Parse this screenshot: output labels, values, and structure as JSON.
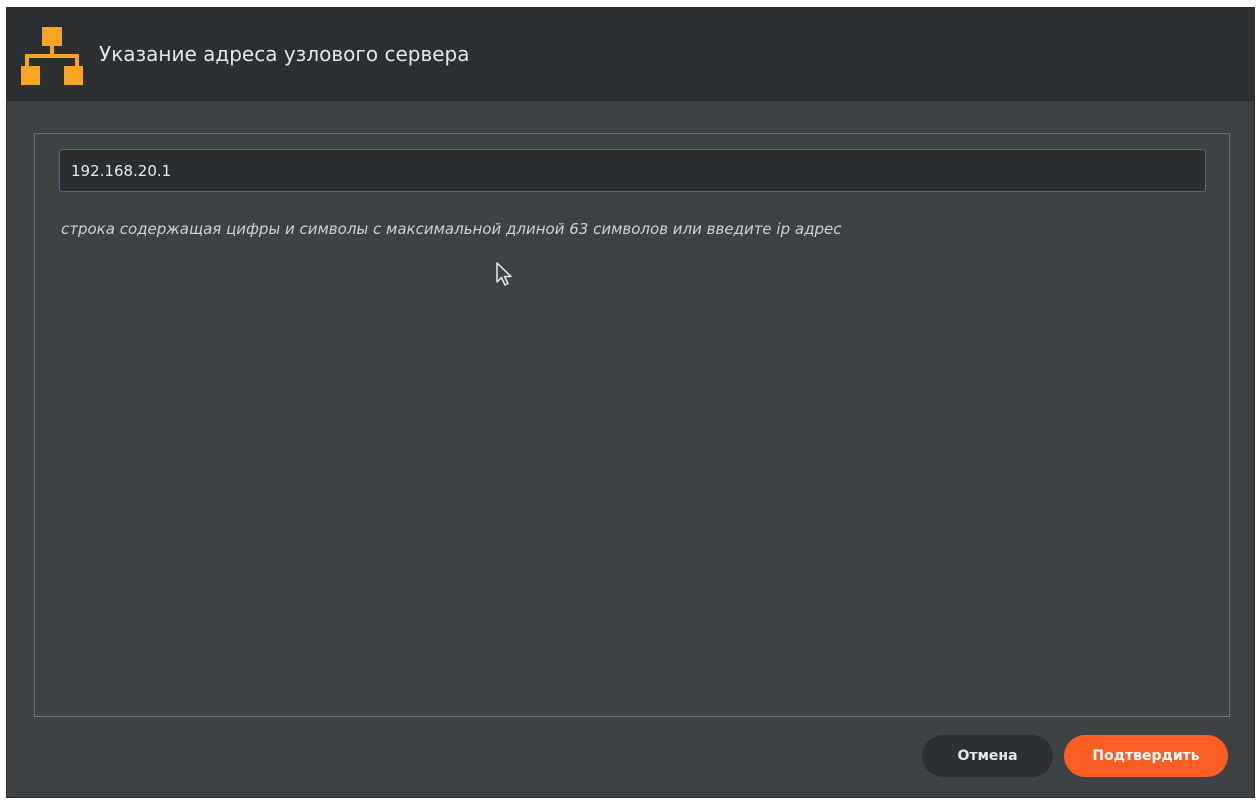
{
  "dialog": {
    "title": "Указание адреса узлового сервера",
    "icon": "network-topology-icon"
  },
  "host_field": {
    "value": "192.168.20.1",
    "hint": "строка содержащая цифры и символы с максимальной длиной 63 символов или введите ip адрес"
  },
  "buttons": {
    "cancel_label": "Отмена",
    "confirm_label": "Подтвердить"
  },
  "colors": {
    "accent": "#fb5e24",
    "icon": "#f7a523",
    "background": "#3f4245",
    "titlebar": "#2d3033"
  }
}
